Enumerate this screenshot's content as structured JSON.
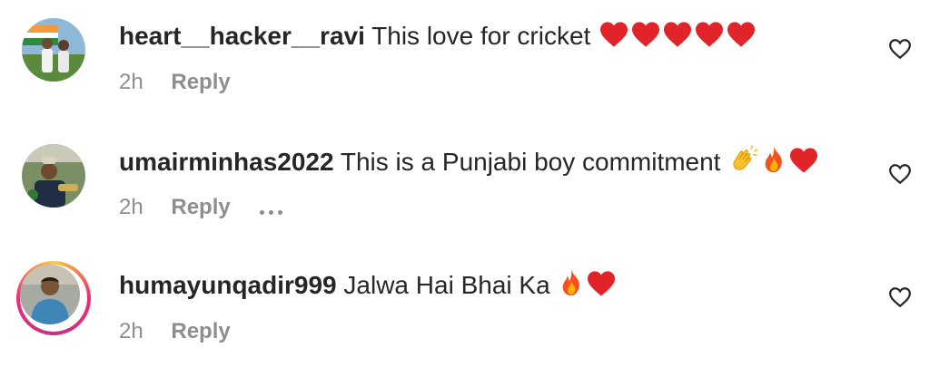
{
  "comments": [
    {
      "username": "heart__hacker__ravi",
      "text": "This love for cricket",
      "emojis": [
        "heart",
        "heart",
        "heart",
        "heart",
        "heart"
      ],
      "time": "2h",
      "reply_label": "Reply",
      "show_more": false
    },
    {
      "username": "umairminhas2022",
      "text": "This is a Punjabi boy commitment",
      "emojis": [
        "clap",
        "fire",
        "heart"
      ],
      "time": "2h",
      "reply_label": "Reply",
      "show_more": true
    },
    {
      "username": "humayunqadir999",
      "text": "Jalwa Hai Bhai Ka",
      "emojis": [
        "fire",
        "heart"
      ],
      "time": "2h",
      "reply_label": "Reply",
      "show_more": false,
      "has_story_ring": true
    }
  ],
  "colors": {
    "text": "#262626",
    "secondary": "#8e8e8e",
    "heart": "#e0242a"
  }
}
